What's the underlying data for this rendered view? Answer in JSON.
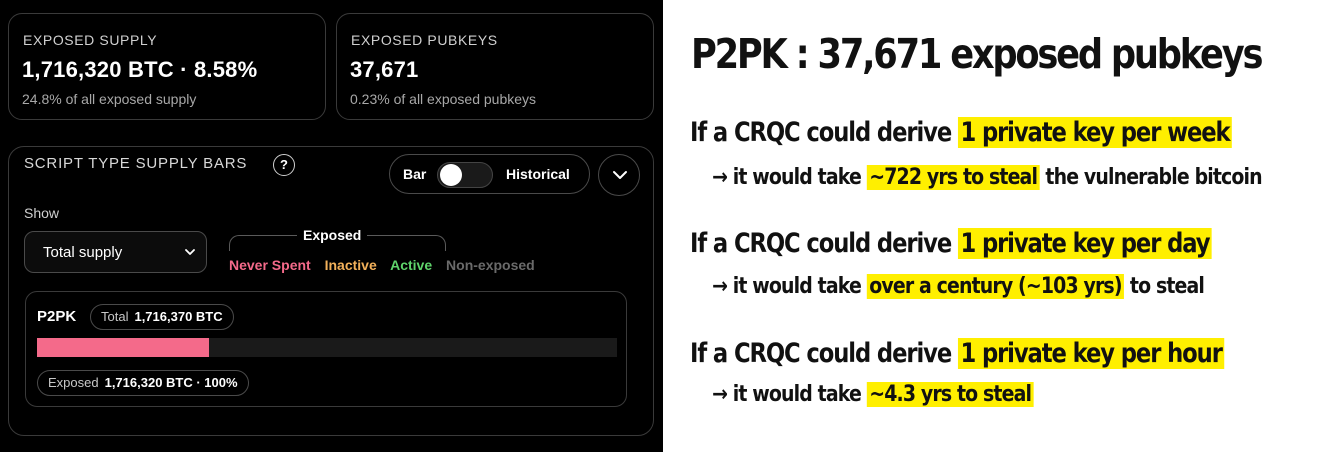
{
  "dashboard": {
    "exposed_supply": {
      "label": "EXPOSED SUPPLY",
      "value": "1,716,320 BTC · 8.58%",
      "subtext": "24.8% of all exposed supply"
    },
    "exposed_pubkeys": {
      "label": "EXPOSED PUBKEYS",
      "value": "37,671",
      "subtext": "0.23% of all exposed pubkeys"
    },
    "panel": {
      "title": "SCRIPT TYPE SUPPLY BARS",
      "help_glyph": "?",
      "toggle_left": "Bar",
      "toggle_right": "Historical",
      "show_label": "Show",
      "select_value": "Total supply",
      "legend": {
        "title": "Exposed",
        "items": [
          {
            "label": "Never Spent",
            "color": "#f46a8a"
          },
          {
            "label": "Inactive",
            "color": "#f3b15a"
          },
          {
            "label": "Active",
            "color": "#5fd46b"
          },
          {
            "label": "Non-exposed",
            "color": "#6a6a6a"
          }
        ]
      },
      "script": {
        "name": "P2PK",
        "total_label": "Total",
        "total_value": "1,716,370 BTC",
        "bar_fraction": 0.296,
        "bar_color": "#f46a8a",
        "exposed_label": "Exposed",
        "exposed_value": "1,716,320 BTC · 100%"
      }
    }
  },
  "slide": {
    "title": "P2PK : 37,671 exposed pubkeys",
    "scenarios": [
      {
        "head_prefix": "If a CRQC could derive ",
        "head_highlight": "1 private key per week",
        "result_prefix": "→ it would take ",
        "result_highlight": "~722 yrs to steal",
        "result_suffix": " the vulnerable bitcoin"
      },
      {
        "head_prefix": "If a CRQC could derive ",
        "head_highlight": "1 private key per day ",
        "result_prefix": "→ it would take ",
        "result_highlight": "over a century (~103 yrs)",
        "result_suffix": " to steal"
      },
      {
        "head_prefix": "If a CRQC could derive ",
        "head_highlight": "1 private key per hour ",
        "result_prefix": "→ it would take ",
        "result_highlight": "~4.3 yrs to steal ",
        "result_suffix": ""
      }
    ],
    "highlight_color": "#ffef00"
  }
}
